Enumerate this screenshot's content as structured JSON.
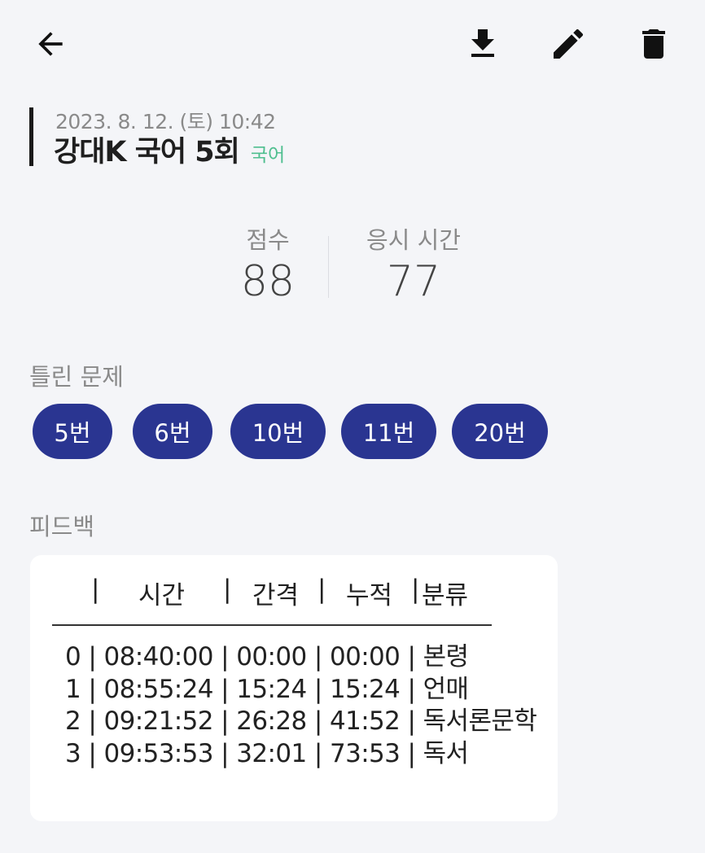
{
  "toolbar": {
    "back_icon": "arrow-left-icon",
    "download_icon": "download-icon",
    "edit_icon": "pencil-icon",
    "delete_icon": "trash-icon"
  },
  "header": {
    "date": "2023. 8. 12. (토) 10:42",
    "title": "강대K 국어 5회",
    "subject": "국어"
  },
  "stats": {
    "score_label": "점수",
    "score_value": "88",
    "time_label": "응시 시간",
    "time_value": "77"
  },
  "wrong": {
    "label": "틀린 문제",
    "chips": [
      "5번",
      "6번",
      "10번",
      "11번",
      "20번"
    ]
  },
  "feedback": {
    "label": "피드백",
    "header_cols": [
      "|",
      "시간",
      "|",
      "간격",
      "|",
      "누적",
      "|",
      "분류"
    ],
    "rows": [
      "0 | 08:40:00 | 00:00 | 00:00 | 본령",
      "1 | 08:55:24 | 15:24 | 15:24 | 언매",
      "2 | 09:21:52 | 26:28 | 41:52 | 독서론문학",
      "3 | 09:53:53 | 32:01 | 73:53 | 독서"
    ]
  },
  "colors": {
    "background": "#f4f5f8",
    "chip": "#2a3591",
    "subject_tag": "#4fbf8f",
    "card": "#ffffff"
  }
}
